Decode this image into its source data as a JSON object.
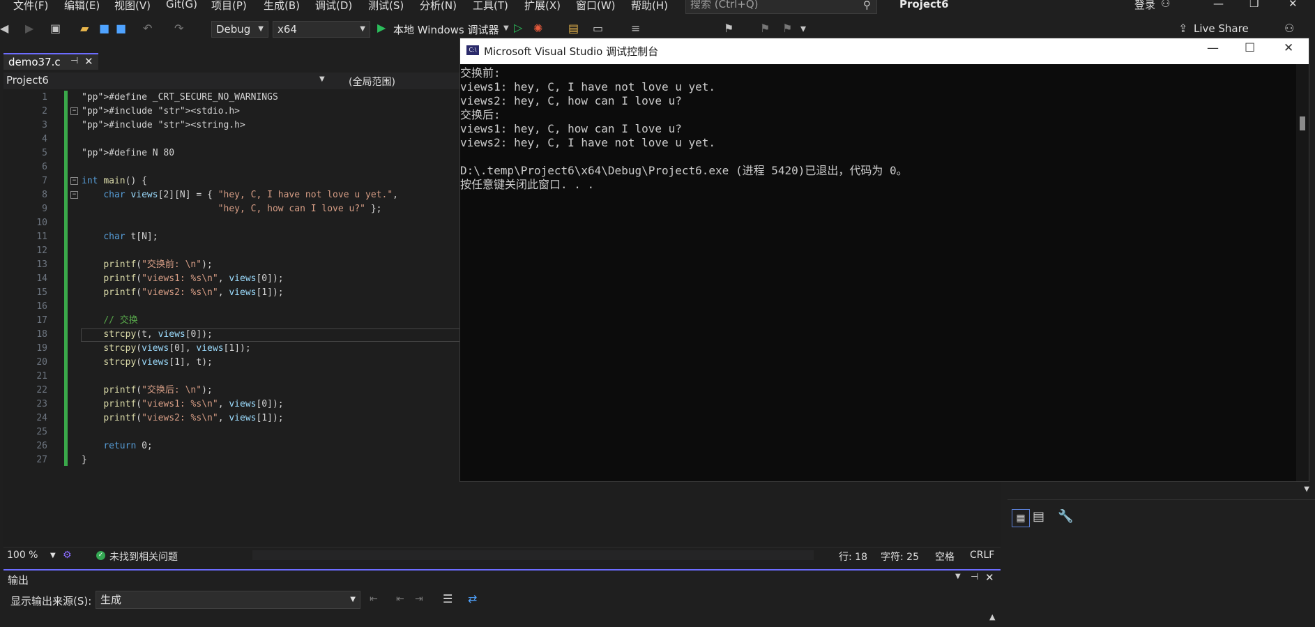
{
  "menu": [
    "文件(F)",
    "编辑(E)",
    "视图(V)",
    "Git(G)",
    "项目(P)",
    "生成(B)",
    "调试(D)",
    "测试(S)",
    "分析(N)",
    "工具(T)",
    "扩展(X)",
    "窗口(W)",
    "帮助(H)"
  ],
  "search_placeholder": "搜索 (Ctrl+Q)",
  "project_title": "Project6",
  "login_label": "登录",
  "toolbar": {
    "config": "Debug",
    "platform": "x64",
    "run_label": "本地 Windows 调试器",
    "live_share": "Live Share"
  },
  "tab": {
    "file": "demo37.c"
  },
  "navbar": {
    "project": "Project6",
    "scope": "(全局范围)"
  },
  "code_lines": [
    "#define _CRT_SECURE_NO_WARNINGS",
    "#include <stdio.h>",
    "#include <string.h>",
    "",
    "#define N 80",
    "",
    "int main() {",
    "    char views[2][N] = { \"hey, C, I have not love u yet.\",",
    "                         \"hey, C, how can I love u?\" };",
    "",
    "    char t[N];",
    "",
    "    printf(\"交换前: \\n\");",
    "    printf(\"views1: %s\\n\", views[0]);",
    "    printf(\"views2: %s\\n\", views[1]);",
    "",
    "    // 交换",
    "    strcpy(t, views[0]);",
    "    strcpy(views[0], views[1]);",
    "    strcpy(views[1], t);",
    "",
    "    printf(\"交换后: \\n\");",
    "    printf(\"views1: %s\\n\", views[0]);",
    "    printf(\"views2: %s\\n\", views[1]);",
    "",
    "    return 0;",
    "}"
  ],
  "line_numbers": [
    "1",
    "2",
    "3",
    "4",
    "5",
    "6",
    "7",
    "8",
    "9",
    "10",
    "11",
    "12",
    "13",
    "14",
    "15",
    "16",
    "17",
    "18",
    "19",
    "20",
    "21",
    "22",
    "23",
    "24",
    "25",
    "26",
    "27"
  ],
  "status": {
    "zoom": "100 %",
    "issues": "未找到相关问题",
    "line": "行: 18",
    "char": "字符: 25",
    "spaces": "空格",
    "eol": "CRLF"
  },
  "output": {
    "title": "输出",
    "source_label": "显示输出来源(S):",
    "source_value": "生成"
  },
  "console": {
    "title": "Microsoft Visual Studio 调试控制台",
    "lines": [
      "交换前:",
      "views1: hey, C, I have not love u yet.",
      "views2: hey, C, how can I love u?",
      "交换后:",
      "views1: hey, C, how can I love u?",
      "views2: hey, C, I have not love u yet.",
      "",
      "D:\\.temp\\Project6\\x64\\Debug\\Project6.exe (进程 5420)已退出，代码为 0。",
      "按任意键关闭此窗口. . ."
    ]
  }
}
